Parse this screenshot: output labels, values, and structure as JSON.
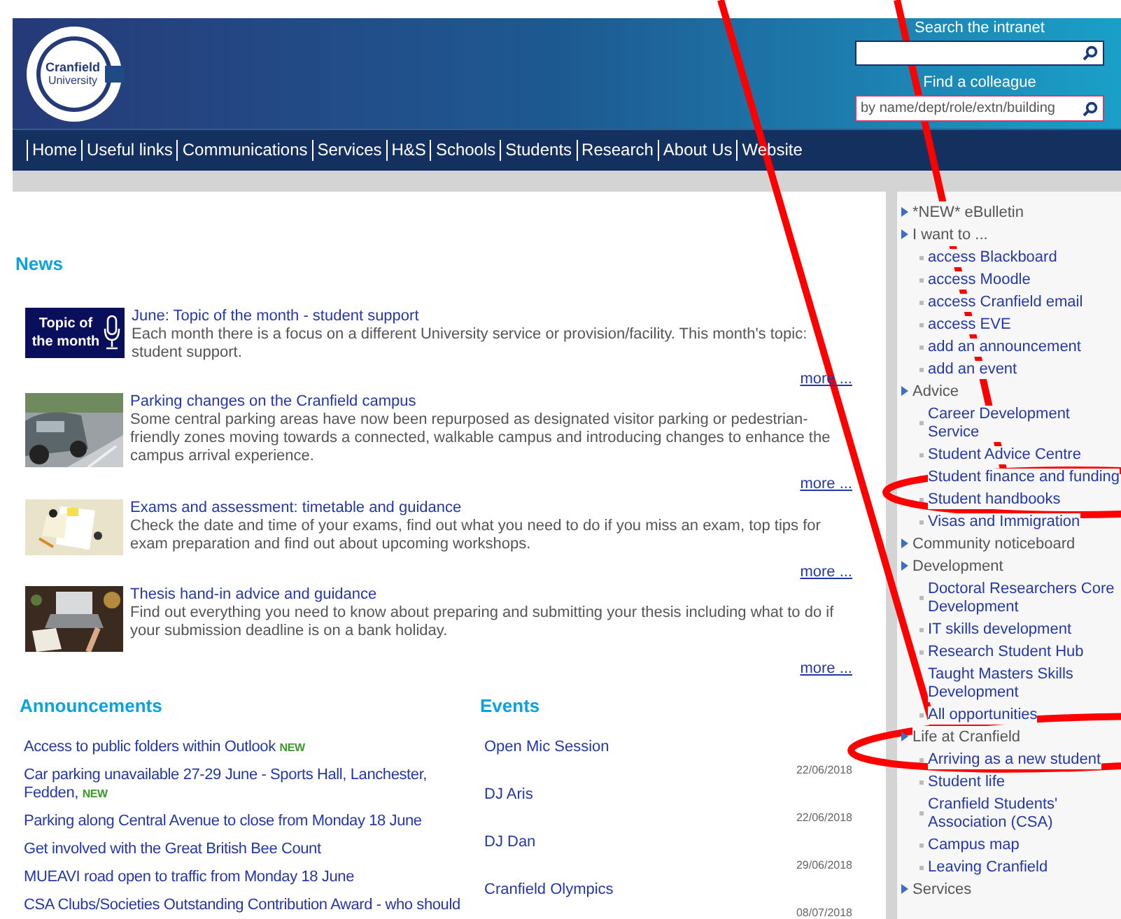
{
  "header": {
    "logo": [
      "Cranfield",
      "University"
    ],
    "search": {
      "label": "Search the intranet"
    },
    "colleague": {
      "label": "Find a colleague",
      "placeholder": "by name/dept/role/extn/building"
    }
  },
  "nav": [
    "Home",
    "Useful links",
    "Communications",
    "Services",
    "H&S",
    "Schools",
    "Students",
    "Research",
    "About Us",
    "Website"
  ],
  "news": {
    "title": "News",
    "items": [
      {
        "kind": "topic",
        "badge": "Topic of the month",
        "title": "June: Topic of the month - student support",
        "text": "Each month there is a focus on a different University service or provision/facility. This month's topic: student support.",
        "more": "more ..."
      },
      {
        "kind": "picture",
        "title": "Parking changes on the Cranfield campus",
        "text": "Some central parking areas have now been repurposed as designated visitor parking or pedestrian-friendly zones moving towards a connected, walkable campus and introducing changes to enhance the campus arrival experience.",
        "more": "more ..."
      },
      {
        "kind": "picture",
        "title": "Exams and assessment: timetable and guidance",
        "text": "Check the date and time of your exams, find out what you need to do if you miss an exam, top tips for exam preparation and find out about upcoming workshops.",
        "more": "more ..."
      },
      {
        "kind": "picture",
        "title": "Thesis hand-in advice and guidance",
        "text": "Find out everything you need to know about preparing and submitting your thesis including what to do if your submission deadline is on a bank holiday.",
        "more": "more ..."
      }
    ]
  },
  "announcements": {
    "title": "Announcements",
    "items": [
      {
        "text": "Access to public folders within Outlook",
        "badge": "NEW"
      },
      {
        "text": "Car parking unavailable 27-29 June - Sports Hall, Lanchester, Fedden,",
        "badge": "NEW"
      },
      {
        "text": "Parking along Central Avenue to close from Monday 18 June"
      },
      {
        "text": "Get involved with the Great British Bee Count"
      },
      {
        "text": "MUEAVI road open to traffic from Monday 18 June"
      },
      {
        "text": "CSA Clubs/Societies Outstanding Contribution Award - who should"
      }
    ]
  },
  "events": {
    "title": "Events",
    "items": [
      {
        "title": "Open Mic Session",
        "date": "22/06/2018"
      },
      {
        "title": "DJ Aris",
        "date": "22/06/2018"
      },
      {
        "title": "DJ Dan",
        "date": "29/06/2018"
      },
      {
        "title": "Cranfield Olympics",
        "date": "08/07/2018"
      }
    ]
  },
  "sidebar": [
    {
      "label": "*NEW* eBulletin"
    },
    {
      "label": "I want to ...",
      "children": [
        "access Blackboard",
        "access Moodle",
        "access Cranfield email",
        "access EVE",
        "add an announcement",
        "add an event"
      ]
    },
    {
      "label": "Advice",
      "children": [
        "Career Development Service",
        "Student Advice Centre",
        "Student finance and funding",
        "Student handbooks",
        "Visas and Immigration"
      ]
    },
    {
      "label": "Community noticeboard"
    },
    {
      "label": "Development",
      "children": [
        "Doctoral Researchers Core Development",
        "IT skills development",
        "Research Student Hub",
        "Taught Masters Skills Development",
        "All opportunities"
      ]
    },
    {
      "label": "Life at Cranfield",
      "children": [
        "Arriving as a new student",
        "Student life",
        "Cranfield Students' Association (CSA)",
        "Campus map",
        "Leaving Cranfield"
      ]
    },
    {
      "label": "Services"
    }
  ]
}
